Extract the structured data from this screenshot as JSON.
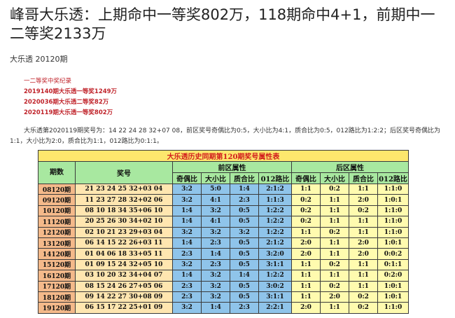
{
  "title": "峰哥大乐透：上期命中一等奖802万，118期命中4+1，前期中一二等奖2133万",
  "subtitle": "大乐透 20120期",
  "records": [
    "一二等奖中奖纪录",
    "2019140期大乐透一等奖1249万",
    "2020036期大乐透二等奖82万",
    "2020119期大乐透一等奖802万"
  ],
  "body_text": "大乐透第2020119期奖号为：14 22 24 28 32+07 08，前区奖号奇偶比为0:5，大小比为4:1，质合比为0:5，012路比为1:2:2；后区奖号奇偶比为1:1，大小比为2:0，质合比为1:1，012路比为0:1:1。",
  "table": {
    "caption": "大乐透历史同期第120期奖号属性表",
    "col_period": "期数",
    "col_number": "奖号",
    "group_front": "前区属性",
    "group_back": "后区属性",
    "sub_headers": [
      "奇偶比",
      "大小比",
      "质合比",
      "012路比",
      "奇偶比",
      "大小比",
      "质合比",
      "012路比"
    ],
    "rows": [
      {
        "period": "08120期",
        "number": "21 23 24 25 32+03 04",
        "f_oe": "3:2",
        "f_bs": "5:0",
        "f_pc": "1:4",
        "f_012": "2:1:2",
        "b_oe": "1:1",
        "b_bs": "0:2",
        "b_pc": "1:1",
        "b_012": "1:1:0"
      },
      {
        "period": "09120期",
        "number": "11 23 27 28 32+02 06",
        "f_oe": "3:2",
        "f_bs": "4:1",
        "f_pc": "2:3",
        "f_012": "1:1:3",
        "b_oe": "0:2",
        "b_bs": "1:1",
        "b_pc": "2:0",
        "b_012": "1:0:1"
      },
      {
        "period": "10120期",
        "number": "08 10 18 34 35+06 10",
        "f_oe": "1:4",
        "f_bs": "3:2",
        "f_pc": "0:5",
        "f_012": "1:2:2",
        "b_oe": "0:2",
        "b_bs": "1:1",
        "b_pc": "0:2",
        "b_012": "1:1:0"
      },
      {
        "period": "11120期",
        "number": "20 25 26 30 34+02 10",
        "f_oe": "1:4",
        "f_bs": "4:1",
        "f_pc": "0:5",
        "f_012": "1:2:2",
        "b_oe": "0:2",
        "b_bs": "1:1",
        "b_pc": "1:1",
        "b_012": "1:1:0"
      },
      {
        "period": "12120期",
        "number": "02 10 21 23 29+03 04",
        "f_oe": "3:2",
        "f_bs": "3:2",
        "f_pc": "3:2",
        "f_012": "1:2:2",
        "b_oe": "1:1",
        "b_bs": "0:2",
        "b_pc": "1:1",
        "b_012": "1:1:0"
      },
      {
        "period": "13120期",
        "number": "06 14 15 22 26+03 11",
        "f_oe": "1:4",
        "f_bs": "2:3",
        "f_pc": "0:5",
        "f_012": "2:1:2",
        "b_oe": "2:0",
        "b_bs": "1:1",
        "b_pc": "2:0",
        "b_012": "1:0:1"
      },
      {
        "period": "14120期",
        "number": "01 04 06 18 33+05 11",
        "f_oe": "2:3",
        "f_bs": "1:4",
        "f_pc": "0:5",
        "f_012": "3:2:0",
        "b_oe": "2:0",
        "b_bs": "1:1",
        "b_pc": "2:0",
        "b_012": "0:0:2"
      },
      {
        "period": "15120期",
        "number": "01 09 15 24 32+05 10",
        "f_oe": "3:2",
        "f_bs": "2:3",
        "f_pc": "0:5",
        "f_012": "3:1:1",
        "b_oe": "1:1",
        "b_bs": "0:2",
        "b_pc": "1:1",
        "b_012": "0:1:1"
      },
      {
        "period": "16120期",
        "number": "03 10 20 32 34+04 07",
        "f_oe": "1:4",
        "f_bs": "3:2",
        "f_pc": "1:4",
        "f_012": "1:2:2",
        "b_oe": "1:1",
        "b_bs": "1:1",
        "b_pc": "1:1",
        "b_012": "0:2:0"
      },
      {
        "period": "17120期",
        "number": "08 15 24 26 27+05 06",
        "f_oe": "2:3",
        "f_bs": "3:2",
        "f_pc": "0:5",
        "f_012": "3:0:2",
        "b_oe": "1:1",
        "b_bs": "0:2",
        "b_pc": "1:1",
        "b_012": "1:0:1"
      },
      {
        "period": "18120期",
        "number": "09 14 22 27 30+08 09",
        "f_oe": "2:3",
        "f_bs": "3:2",
        "f_pc": "0:5",
        "f_012": "3:1:1",
        "b_oe": "1:1",
        "b_bs": "2:0",
        "b_pc": "0:2",
        "b_012": "1:0:1"
      },
      {
        "period": "19120期",
        "number": "06 15 17 22 25+01 09",
        "f_oe": "3:2",
        "f_bs": "1:4",
        "f_pc": "2:3",
        "f_012": "2:2:1",
        "b_oe": "2:0",
        "b_bs": "1:1",
        "b_pc": "0:2",
        "b_012": "1:1:0"
      }
    ]
  },
  "colors": {
    "caption_bg": "#fde76d",
    "caption_text": "#d21d1d",
    "header_bg": "#a8e8a0",
    "period_bg": "#f4b98a",
    "number_bg": "#ffe6b0",
    "front_bg": "#8fc4ea",
    "back_bg": "#fffbaf",
    "record_text": "#c0242b"
  }
}
